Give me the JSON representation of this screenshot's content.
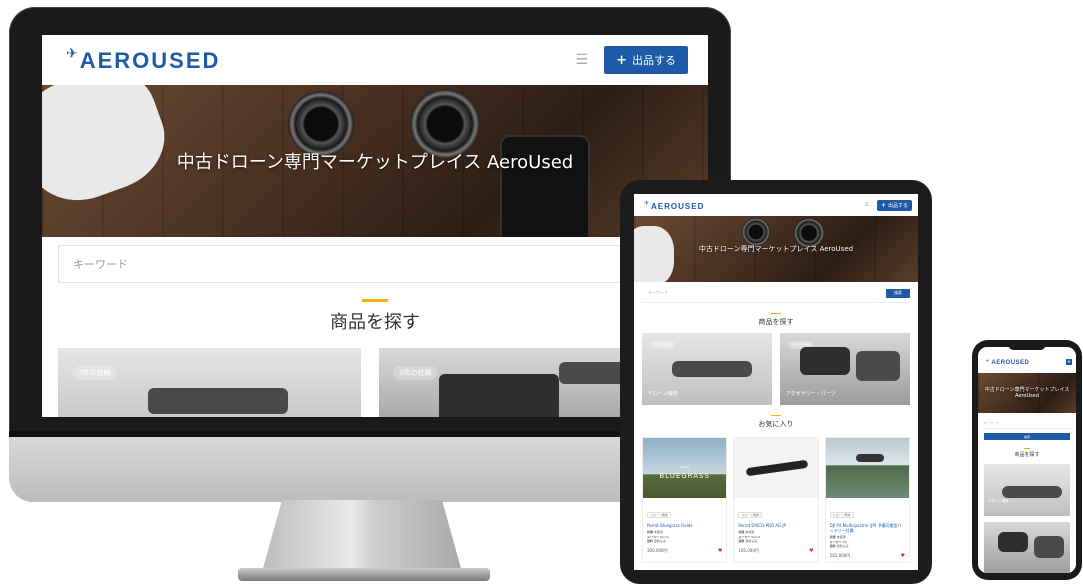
{
  "brand": {
    "logo_text": "AEROUSED",
    "accent_color": "#1e5aa8",
    "highlight_color": "#f5b400"
  },
  "header": {
    "menu_icon": "hamburger-icon",
    "list_button_label": "出品する"
  },
  "hero": {
    "title": "中古ドローン専門マーケットプレイス AeroUsed"
  },
  "search": {
    "placeholder": "キーワード",
    "button_label": "検索"
  },
  "categories_section": {
    "title": "商品を探す",
    "items": [
      {
        "badge": "7件の投稿",
        "label": "ドローン機体"
      },
      {
        "badge": "3件の投稿",
        "label": "アクセサリー・パーツ"
      }
    ]
  },
  "favorites_section": {
    "title": "お気に入り",
    "items": [
      {
        "image_text": "BLUEGRASS",
        "image_brand": "Parrot",
        "tag": "ドローン機体",
        "name": "Parrot Bluegrass Fields",
        "condition_label": "状態",
        "condition": "未使用",
        "maker_label": "メーカー",
        "maker": "Parrot",
        "shipping_label": "送料",
        "shipping": "送料込み",
        "price": "300,000円"
      },
      {
        "image_text": "",
        "image_brand": "",
        "tag": "ドローン機体",
        "name": "Parrot DISCO-PRO AG JP",
        "condition_label": "状態",
        "condition": "未使用",
        "maker_label": "メーカー",
        "maker": "Parrot",
        "shipping_label": "送料",
        "shipping": "送料込み",
        "price": "165,000円"
      },
      {
        "image_text": "",
        "image_brand": "",
        "tag": "ドローン機体",
        "name": "DJI P4 Multispectral (JP) 予備可搬型バッテリー付属",
        "condition_label": "状態",
        "condition": "未使用",
        "maker_label": "メーカー",
        "maker": "DJI",
        "shipping_label": "送料",
        "shipping": "送料込み",
        "price": "242,000円"
      }
    ]
  }
}
